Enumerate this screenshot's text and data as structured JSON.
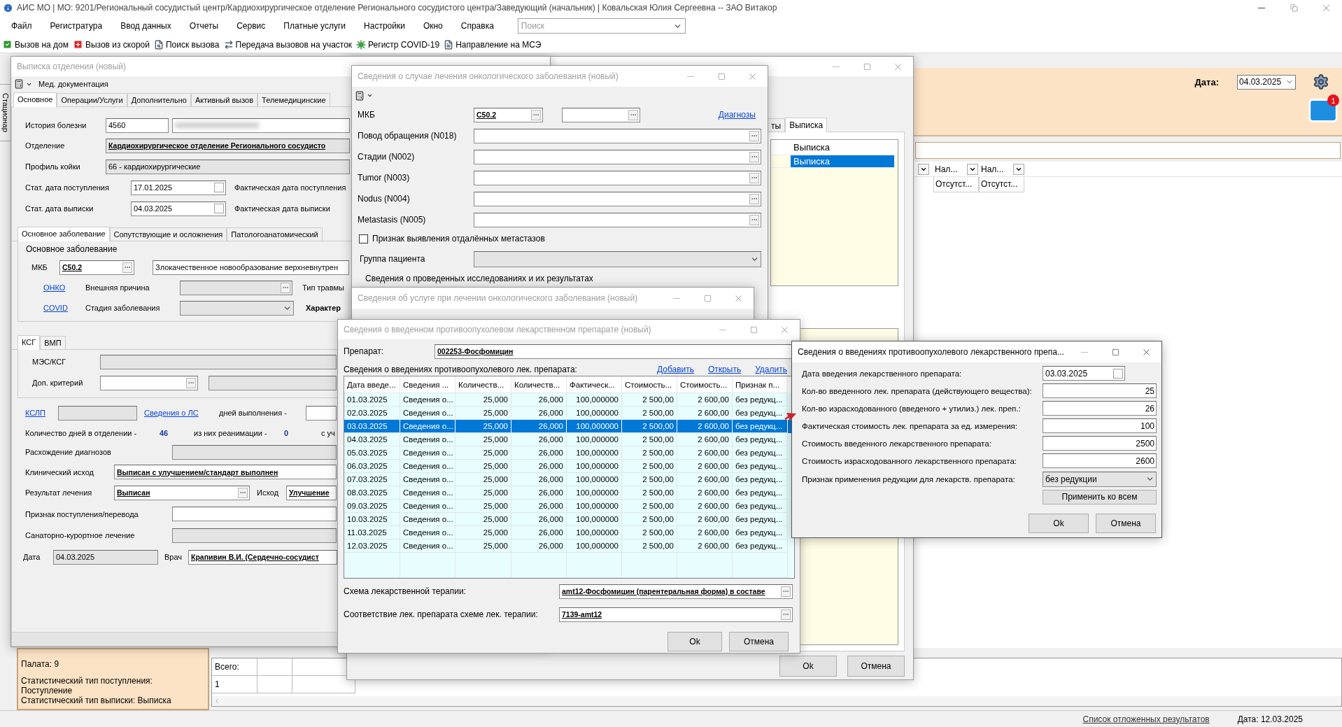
{
  "window": {
    "title": "АИС МО | МО: 9201/Региональный сосудистый центр/Кардиохирургическое отделение Регионального сосудистого центра/Заведующий (начальник) | Ковальская Юлия Сергеевна -- ЗАО Витакор"
  },
  "menu": [
    "Файл",
    "Регистратура",
    "Ввод данных",
    "Отчеты",
    "Сервис",
    "Платные услуги",
    "Настройки",
    "Окно",
    "Справка"
  ],
  "search": {
    "placeholder": "Поиск"
  },
  "toolbar": [
    {
      "label": "Вызов на дом"
    },
    {
      "label": "Вызов из скорой"
    },
    {
      "label": "Поиск вызова"
    },
    {
      "label": "Передача вызовов на участок"
    },
    {
      "label": "Регистр COVID-19"
    },
    {
      "label": "Направление на МСЭ"
    }
  ],
  "side_tab": {
    "label": "Стационар"
  },
  "header": {
    "date_label": "Дата:",
    "date": "04.03.2025",
    "mail_badge": "1"
  },
  "list": {
    "columns": [
      "Нал...",
      "Нал..."
    ],
    "row": [
      "Отсутст...",
      "Отсутст..."
    ]
  },
  "patient_info": [
    "Палата: 9",
    "Статистический тип поступления:",
    "Поступление",
    "Статистический тип выписки: Выписка"
  ],
  "totals": {
    "label": "Всего:",
    "value": "1"
  },
  "status_bar": {
    "link": "Список отложенных результатов",
    "date": "Дата: 12.03.2025"
  },
  "back_window": {
    "tabs": [
      {
        "label": "ты",
        "selected": false
      },
      {
        "label": "Выписка",
        "selected": true
      }
    ],
    "column": "Выписка",
    "rows": [
      {
        "cell": "Выписка",
        "selected": true
      }
    ],
    "buttons": [
      "Ok",
      "Отмена"
    ]
  },
  "discharge": {
    "title": "Выписка отделения (новый)",
    "toolbar": "Мед. документация",
    "tabs": [
      {
        "label": "Основное",
        "selected": true
      },
      {
        "label": "Операции/Услуги",
        "selected": false
      },
      {
        "label": "Дополнительно",
        "selected": false
      },
      {
        "label": "Активный вызов",
        "selected": false
      },
      {
        "label": "Телемедицинские",
        "selected": false
      }
    ],
    "history": {
      "label": "История болезни",
      "value": "4560"
    },
    "department": {
      "label": "Отделение",
      "value": "Кардиохирургическое отделение Регионального сосудисто"
    },
    "bed_profile": {
      "label": "Профиль койки",
      "value": "66 - кардиохирургические"
    },
    "admission": {
      "label": "Стат. дата поступления",
      "value": "17.01.2025",
      "actual_label": "Фактическая дата поступления"
    },
    "release": {
      "label": "Стат. дата выписки",
      "value": "04.03.2025",
      "actual_label": "Фактическая дата выписки"
    },
    "disease_tabs": [
      {
        "label": "Основное заболевание",
        "selected": true
      },
      {
        "label": "Сопутствующие и осложнения",
        "selected": false
      },
      {
        "label": "Патологоанатомический",
        "selected": false
      }
    ],
    "main_disease": {
      "legend": "Основное заболевание",
      "mkb_label": "МКБ",
      "mkb": "C50.2",
      "diagnosis": "Злокачественное новообразование верхневнутрен",
      "onko_link": "ОНКО",
      "external_cause": "Внешняя причина",
      "injury_type": "Тип травмы",
      "covid_link": "COVID",
      "stage": "Стадия заболевания",
      "character": "Характер"
    },
    "ksg_tabs": [
      {
        "label": "КСГ",
        "selected": true
      },
      {
        "label": "ВМП",
        "selected": false
      }
    ],
    "mes_label": "МЭС/КСГ",
    "extra_label": "Доп. критерий",
    "kslp_link": "КСЛП",
    "drugs_link": "Сведения о ЛС",
    "days_done": "дней выполнения -",
    "days": {
      "label": "Количество дней в отделении -",
      "value": "46",
      "icu_label": "из них реанимации -",
      "icu_value": "0",
      "tail": "с уч"
    },
    "divergence": "Расхождение диагнозов",
    "clinical": {
      "label": "Клинический исход",
      "value": "Выписан с улучшением/стандарт выполнен"
    },
    "result": {
      "label": "Результат лечения",
      "value": "Выписан",
      "outcome_label": "Исход",
      "outcome": "Улучшение"
    },
    "transfer": "Признак поступления/перевода",
    "sanatorium": "Санаторно-курортное лечение",
    "date": {
      "label": "Дата",
      "value": "04.03.2025",
      "doctor_label": "Врач",
      "doctor": "Крапивин В.И. (Сердечно-сосудист"
    }
  },
  "onco": {
    "title": "Сведения о случае лечения онкологического заболевания (новый)",
    "mkb_label": "МКБ",
    "mkb": "C50.2",
    "diagnoses_link": "Диагнозы",
    "fields": [
      "Повод обращения (N018)",
      "Стадии (N002)",
      "Tumor (N003)",
      "Nodus (N004)",
      "Metastasis (N005)"
    ],
    "metastases": {
      "label": "Признак выявления отдалённых метастазов",
      "checked": false
    },
    "group_label": "Группа пациента",
    "research_legend": "Сведения о проведенных исследованиях и их результатах"
  },
  "service": {
    "title": "Сведения об услуге при лечении онкологического заболевания (новый)"
  },
  "drug": {
    "title": "Сведения о введенном противоопухолевом лекарственном препарате (новый)",
    "drug_label": "Препарат:",
    "drug": "002253-Фосфомицин",
    "list_label": "Сведения о введениях противоопухолевого лек. препарата:",
    "links": [
      "Добавить",
      "Открыть",
      "Удалить"
    ],
    "columns": [
      "Дата введе...",
      "Сведения ...",
      "Количеств...",
      "Количеств...",
      "Фактическ...",
      "Стоимость...",
      "Стоимость...",
      "Признак п..."
    ],
    "rows": [
      {
        "cells": [
          "01.03.2025",
          "Сведения о...",
          "25,000",
          "26,000",
          "100,000000",
          "2 500,00",
          "2 600,00",
          "без редукц..."
        ],
        "selected": false
      },
      {
        "cells": [
          "02.03.2025",
          "Сведения о...",
          "25,000",
          "26,000",
          "100,000000",
          "2 500,00",
          "2 600,00",
          "без редукц..."
        ],
        "selected": false
      },
      {
        "cells": [
          "03.03.2025",
          "Сведения о...",
          "25,000",
          "26,000",
          "100,000000",
          "2 500,00",
          "2 600,00",
          "без редукц..."
        ],
        "selected": true
      },
      {
        "cells": [
          "04.03.2025",
          "Сведения о...",
          "25,000",
          "26,000",
          "100,000000",
          "2 500,00",
          "2 600,00",
          "без редукц..."
        ],
        "selected": false
      },
      {
        "cells": [
          "05.03.2025",
          "Сведения о...",
          "25,000",
          "26,000",
          "100,000000",
          "2 500,00",
          "2 600,00",
          "без редукц..."
        ],
        "selected": false
      },
      {
        "cells": [
          "06.03.2025",
          "Сведения о...",
          "25,000",
          "26,000",
          "100,000000",
          "2 500,00",
          "2 600,00",
          "без редукц..."
        ],
        "selected": false
      },
      {
        "cells": [
          "07.03.2025",
          "Сведения о...",
          "25,000",
          "26,000",
          "100,000000",
          "2 500,00",
          "2 600,00",
          "без редукц..."
        ],
        "selected": false
      },
      {
        "cells": [
          "08.03.2025",
          "Сведения о...",
          "25,000",
          "26,000",
          "100,000000",
          "2 500,00",
          "2 600,00",
          "без редукц..."
        ],
        "selected": false
      },
      {
        "cells": [
          "09.03.2025",
          "Сведения о...",
          "25,000",
          "26,000",
          "100,000000",
          "2 500,00",
          "2 600,00",
          "без редукц..."
        ],
        "selected": false
      },
      {
        "cells": [
          "10.03.2025",
          "Сведения о...",
          "25,000",
          "26,000",
          "100,000000",
          "2 500,00",
          "2 600,00",
          "без редукц..."
        ],
        "selected": false
      },
      {
        "cells": [
          "11.03.2025",
          "Сведения о...",
          "25,000",
          "26,000",
          "100,000000",
          "2 500,00",
          "2 600,00",
          "без редукц..."
        ],
        "selected": false
      },
      {
        "cells": [
          "12.03.2025",
          "Сведения о...",
          "25,000",
          "26,000",
          "100,000000",
          "2 500,00",
          "2 600,00",
          "без редукц..."
        ],
        "selected": false
      }
    ],
    "scheme_label": "Схема лекарственной терапии:",
    "scheme": "amt12-Фосфомицин (парентеральная форма) в составе",
    "match_label": "Соответствие лек. препарата схеме лек. терапии:",
    "match": "7139-amt12",
    "buttons": [
      "Ok",
      "Отмена"
    ]
  },
  "admin": {
    "title": "Сведения о введениях противоопухолевого лекарственного препа...",
    "fields": [
      {
        "label": "Дата введения лекарственного препарата:",
        "value": "03.03.2025",
        "kind": "date"
      },
      {
        "label": "Кол-во введенного лек. препарата (действующего вещества):",
        "value": "25",
        "kind": "number"
      },
      {
        "label": "Кол-во израсходованного (введеного + утилиз.) лек. преп.:",
        "value": "26",
        "kind": "number"
      },
      {
        "label": "Фактическая стоимость лек. препарата за ед. измерения:",
        "value": "100",
        "kind": "number"
      },
      {
        "label": "Стоимость введенного лекарственного препарата:",
        "value": "2500",
        "kind": "number"
      },
      {
        "label": "Стоимость израсходованного лекарственного препарата:",
        "value": "2600",
        "kind": "number"
      },
      {
        "label": "Признак применения редукции для лекарств. препарата:",
        "value": "без редукции",
        "kind": "select"
      }
    ],
    "apply_button": "Применить ко всем",
    "buttons": [
      "Ok",
      "Отмена"
    ]
  }
}
